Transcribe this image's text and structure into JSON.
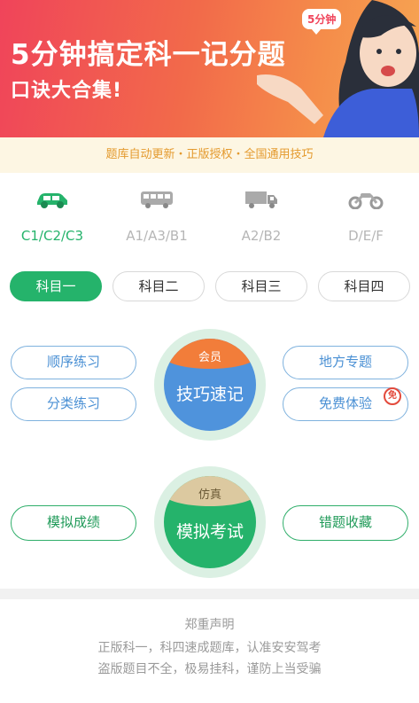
{
  "banner": {
    "title": "5分钟搞定科一记分题",
    "subtitle": "口诀大合集!",
    "bubble": "5分钟"
  },
  "strip": {
    "text": "题库自动更新・正版授权・全国通用技巧"
  },
  "license_types": [
    {
      "label": "C1/C2/C3",
      "icon": "car-icon",
      "active": true
    },
    {
      "label": "A1/A3/B1",
      "icon": "bus-icon",
      "active": false
    },
    {
      "label": "A2/B2",
      "icon": "truck-icon",
      "active": false
    },
    {
      "label": "D/E/F",
      "icon": "motorcycle-icon",
      "active": false
    }
  ],
  "subject_tabs": [
    "科目一",
    "科目二",
    "科目三",
    "科目四"
  ],
  "practice": {
    "order": "顺序练习",
    "category": "分类练习",
    "local": "地方专题",
    "free_trial": "免费体验",
    "free_badge": "免",
    "member_cap": "会员",
    "tips": "技巧速记",
    "mock_score": "模拟成绩",
    "mistakes": "错题收藏",
    "sim_cap": "仿真",
    "mock_exam": "模拟考试"
  },
  "notice": {
    "title": "郑重声明",
    "line1": "正版科一，科四速成题库，认准安安驾考",
    "line2": "盗版题目不全，极易挂科，谨防上当受骗"
  },
  "colors": {
    "accent_green": "#25b36b",
    "blue": "#4a90d4",
    "orange_cap": "#f27d3a",
    "banner_red": "#f0445a"
  }
}
